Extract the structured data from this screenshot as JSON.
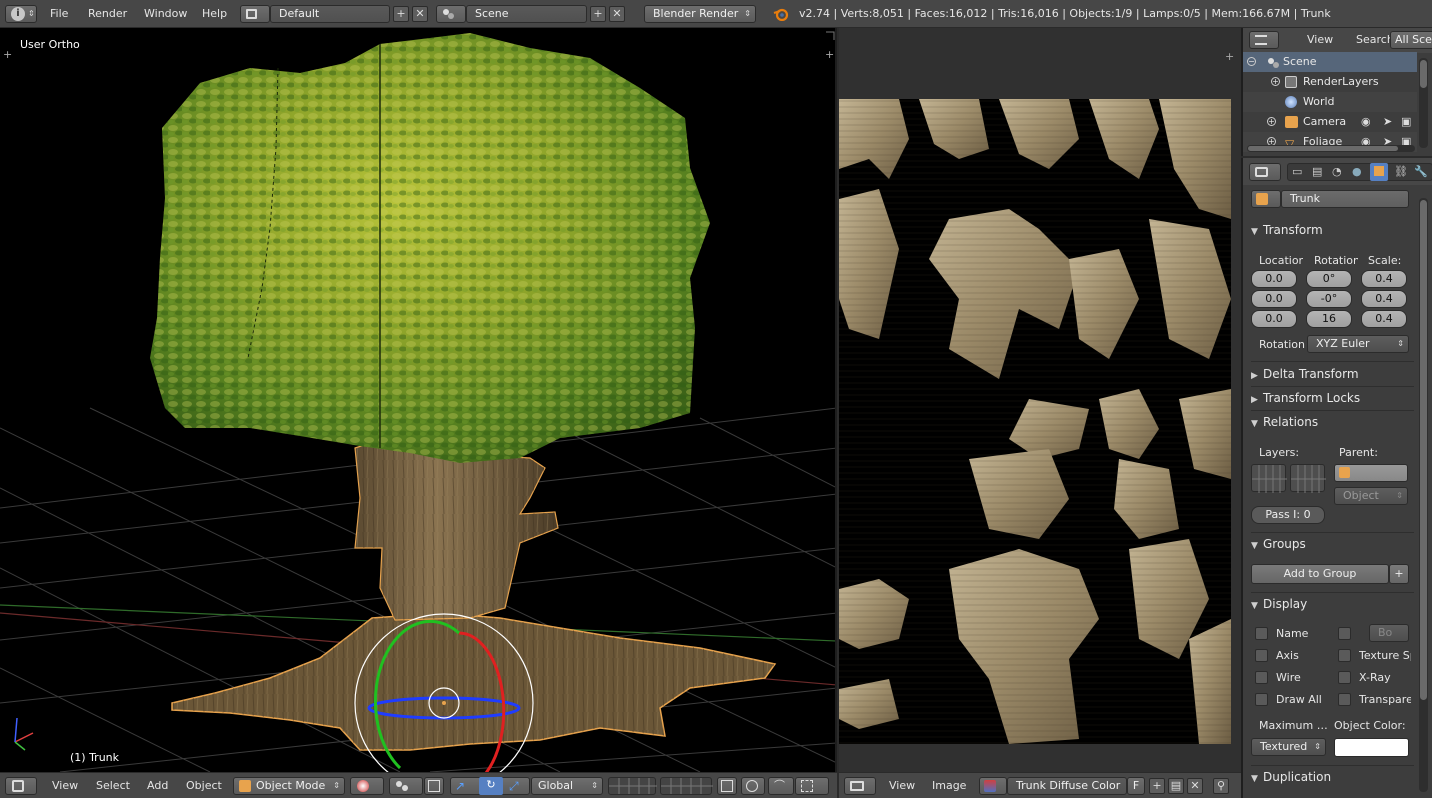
{
  "topbar": {
    "menus": [
      "File",
      "Render",
      "Window",
      "Help"
    ],
    "screen_layout": "Default",
    "scene": "Scene",
    "render_engine": "Blender Render",
    "stats": "v2.74 | Verts:8,051 | Faces:16,012 | Tris:16,016 | Objects:1/9 | Lamps:0/5 | Mem:166.67M | Trunk"
  },
  "viewport": {
    "view_label": "User Ortho",
    "object_label": "(1) Trunk",
    "header": {
      "menus": [
        "View",
        "Select",
        "Add",
        "Object"
      ],
      "mode": "Object Mode",
      "orientation": "Global"
    }
  },
  "uv_editor": {
    "header": {
      "menus": [
        "View",
        "Image"
      ],
      "image_name": "Trunk Diffuse Color",
      "fake_user": "F"
    }
  },
  "outliner": {
    "header": {
      "view": "View",
      "search": "Search",
      "filter": "All Scenes"
    },
    "rows": [
      {
        "label": "Scene",
        "icon": "scene-icon"
      },
      {
        "label": "RenderLayers",
        "icon": "renderlayer-icon"
      },
      {
        "label": "World",
        "icon": "world-icon"
      },
      {
        "label": "Camera",
        "icon": "camera-icon"
      },
      {
        "label": "Foliage",
        "icon": "mesh-icon"
      }
    ]
  },
  "properties": {
    "object_name": "Trunk",
    "transform": {
      "title": "Transform",
      "location_label": "Location:",
      "rotation_label": "Rotation:",
      "scale_label": "Scale:",
      "location": [
        "0.0",
        "0.0",
        "0.0"
      ],
      "rotation": [
        "0°",
        "-0°",
        "16"
      ],
      "scale": [
        "0.4",
        "0.4",
        "0.4"
      ],
      "rotation_mode_label": "Rotation",
      "rotation_mode": "XYZ Euler"
    },
    "delta_transform": "Delta Transform",
    "transform_locks": "Transform Locks",
    "relations": {
      "title": "Relations",
      "layers_label": "Layers:",
      "parent_label": "Parent:",
      "parent_type": "Object",
      "pass_index": "Pass I:  0"
    },
    "groups": {
      "title": "Groups",
      "add_to_group": "Add to Group"
    },
    "display": {
      "title": "Display",
      "left_checks": [
        "Name",
        "Axis",
        "Wire",
        "Draw All"
      ],
      "right_checks": [
        "Texture Space",
        "X-Ray",
        "Transparency"
      ],
      "bounds_type": "Bo",
      "max_draw_label": "Maximum Draw Type:",
      "object_color_label": "Object Color:",
      "max_draw": "Textured"
    },
    "duplication": "Duplication"
  }
}
